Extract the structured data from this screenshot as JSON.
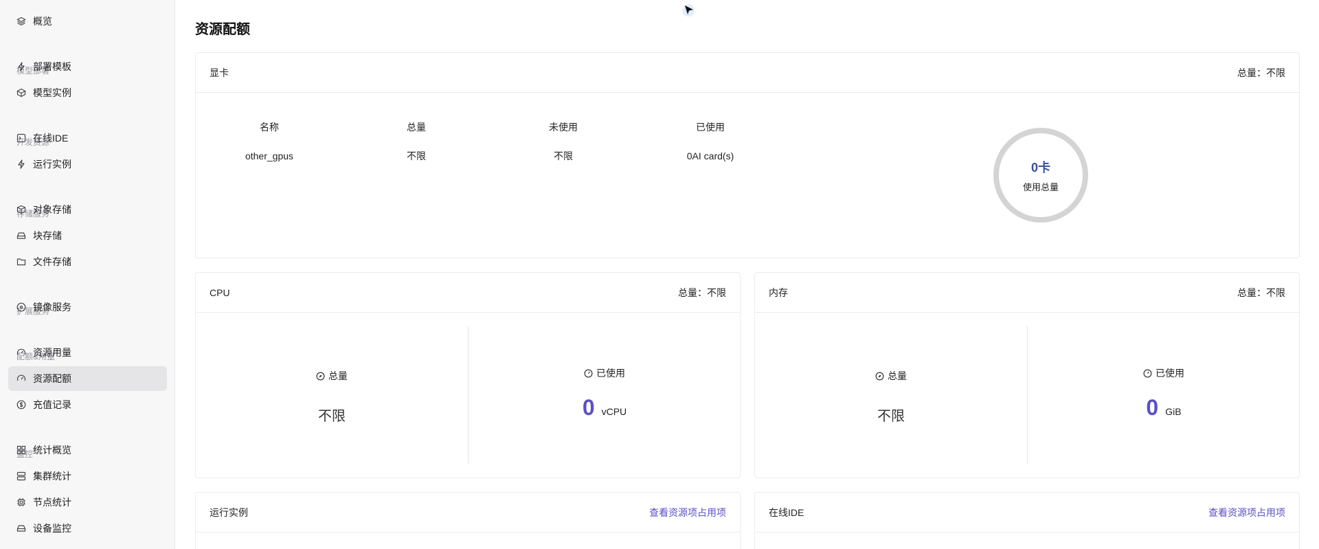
{
  "sidebar": {
    "items": [
      {
        "label": "概览",
        "icon": "layers-icon"
      },
      {
        "group": "模型部署"
      },
      {
        "label": "部署模板",
        "icon": "bolt-icon"
      },
      {
        "label": "模型实例",
        "icon": "cube-icon"
      },
      {
        "group": "开发资源"
      },
      {
        "label": "在线IDE",
        "icon": "terminal-icon"
      },
      {
        "label": "运行实例",
        "icon": "bolt-icon"
      },
      {
        "group": "存储服务"
      },
      {
        "label": "对象存储",
        "icon": "box-icon"
      },
      {
        "label": "块存储",
        "icon": "drive-icon"
      },
      {
        "label": "文件存储",
        "icon": "folder-icon"
      },
      {
        "group": "扩展服务"
      },
      {
        "label": "镜像服务",
        "icon": "disc-icon"
      },
      {
        "group": "配额&用量"
      },
      {
        "label": "资源用量",
        "icon": "gauge-icon"
      },
      {
        "label": "资源配额",
        "icon": "gauge-icon",
        "active": true
      },
      {
        "label": "充值记录",
        "icon": "dollar-icon"
      },
      {
        "group": "监控"
      },
      {
        "label": "统计概览",
        "icon": "grid-icon"
      },
      {
        "label": "集群统计",
        "icon": "server-icon"
      },
      {
        "label": "节点统计",
        "icon": "chip-icon"
      },
      {
        "label": "设备监控",
        "icon": "drive-icon"
      }
    ]
  },
  "page": {
    "title": "资源配额"
  },
  "gpu": {
    "title": "显卡",
    "total": "总量：不限",
    "headers": [
      "名称",
      "总量",
      "未使用",
      "已使用"
    ],
    "rows": [
      [
        "other_gpus",
        "不限",
        "不限",
        "0AI card(s)"
      ]
    ],
    "ring": {
      "value": "0卡",
      "label": "使用总量",
      "fraction": 0
    }
  },
  "cpu": {
    "title": "CPU",
    "total": "总量：不限",
    "total_label": "总量",
    "total_value": "不限",
    "used_label": "已使用",
    "used_value": "0",
    "used_unit": "vCPU"
  },
  "memory": {
    "title": "内存",
    "total": "总量：不限",
    "total_label": "总量",
    "total_value": "不限",
    "used_label": "已使用",
    "used_value": "0",
    "used_unit": "GiB"
  },
  "running": {
    "title": "运行实例",
    "link": "查看资源项占用项"
  },
  "ide": {
    "title": "在线IDE",
    "link": "查看资源项占用项"
  },
  "colors": {
    "accent": "#5b4fc6",
    "ring": "#d4d4d4",
    "ring_text": "#3b4f9a"
  }
}
